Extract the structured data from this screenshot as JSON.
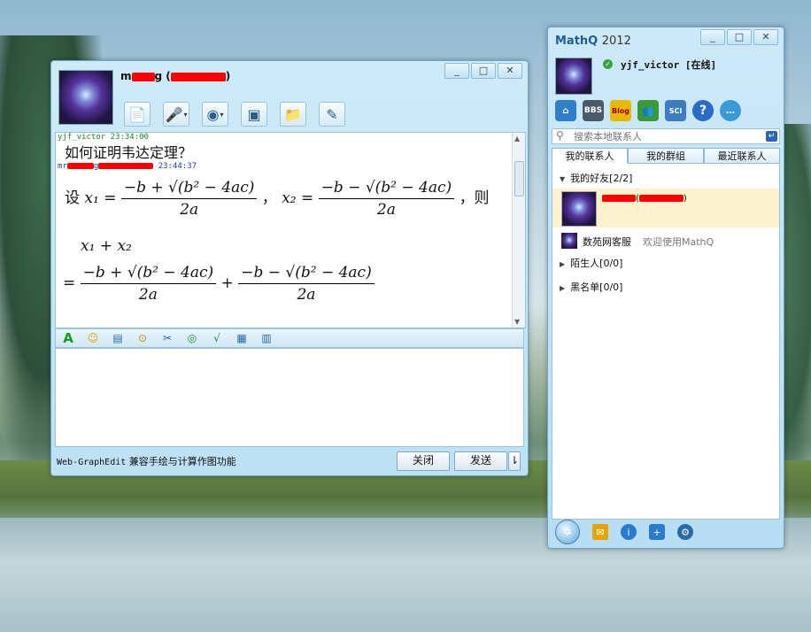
{
  "chat": {
    "window_controls": [
      "_",
      "□",
      "✕"
    ],
    "contact_name_prefix": "m",
    "contact_name_suffix": "g (",
    "contact_name_close": ")",
    "toolbar_icons": [
      "file-send-icon",
      "microphone-icon",
      "webcam-icon",
      "video-share-icon",
      "folder-icon",
      "whiteboard-icon"
    ],
    "messages": [
      {
        "sender": "yjf_victor",
        "time": "23:34:00",
        "text": "如何证明韦达定理？"
      },
      {
        "sender": "mr",
        "sender_suffix": "g",
        "time": "23:44:37"
      }
    ],
    "math": {
      "let": "设",
      "then": "，则",
      "comma": "，",
      "x1_eq": "x₁ =",
      "x2_eq": "x₂ =",
      "num1": "−b + √(b² − 4ac)",
      "num2": "−b − √(b² − 4ac)",
      "den": "2a",
      "sum": "x₁ + x₂",
      "eq": "=",
      "plus": "+"
    },
    "format_icons": [
      "font-icon",
      "emoticon-icon",
      "image-icon",
      "screenshot-icon",
      "shake-icon",
      "bubble-icon",
      "formula-icon",
      "grid-icon",
      "table-icon"
    ],
    "footer_prefix": "Web-GraphEdit",
    "footer_text": " 兼容手绘与计算作图功能",
    "close_label": "关闭",
    "send_label": "发送",
    "send_more": "⇂"
  },
  "contacts": {
    "logo": "MathQ",
    "year": "2012",
    "window_controls": [
      "_",
      "□",
      "✕"
    ],
    "user_name": "yjf_victor [在线]",
    "app_icons": [
      "home-icon",
      "bbs-icon",
      "blog-icon",
      "friends-icon",
      "sci-icon",
      "help-icon",
      "chat-icon"
    ],
    "app_icon_labels": [
      "⌂",
      "BBS",
      "Blog",
      "👥",
      "SCI",
      "?",
      "…"
    ],
    "search_placeholder": "搜索本地联系人",
    "tabs": [
      "我的联系人",
      "我的群组",
      "最近联系人"
    ],
    "groups": {
      "friends": "我的好友[2/2]",
      "strangers": "陌生人[0/0]",
      "blacklist": "黑名单[0/0]"
    },
    "friend_name_open": "(",
    "friend_name_close": ")",
    "service": {
      "name": "数苑网客服",
      "message": "欢迎使用MathQ"
    },
    "bottom_icons": [
      "main-menu-icon",
      "mail-icon",
      "info-icon",
      "add-icon",
      "settings-icon"
    ]
  }
}
